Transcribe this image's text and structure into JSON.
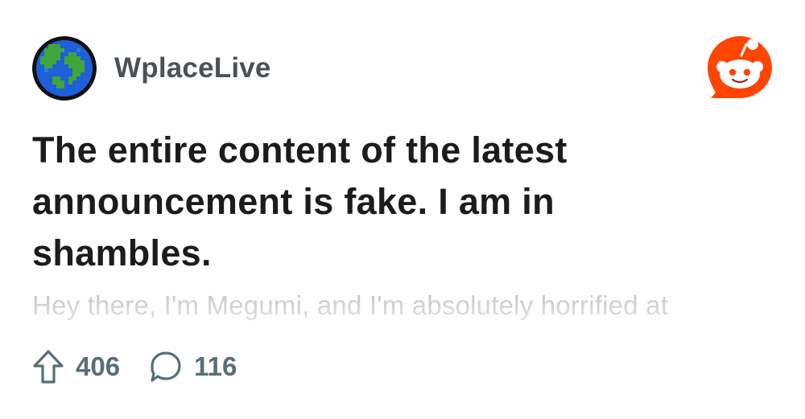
{
  "post": {
    "subreddit": "WplaceLive",
    "title": "The entire content of the latest announcement is fake. I am in shambles.",
    "preview": "Hey there, I'm Megumi, and I'm absolutely horrified at",
    "upvotes": "406",
    "comments": "116"
  },
  "icons": {
    "avatar": "pixel-globe-icon",
    "brand": "reddit-snoo-icon",
    "upvote": "upvote-arrow-icon",
    "comment": "comment-bubble-icon"
  },
  "colors": {
    "reddit_orange": "#ff4500",
    "title_text": "#1c1c1c",
    "meta_text": "#576f76",
    "preview_text": "#c8cbce",
    "globe_ocean": "#1f5fd8",
    "globe_land": "#3fa63c"
  }
}
